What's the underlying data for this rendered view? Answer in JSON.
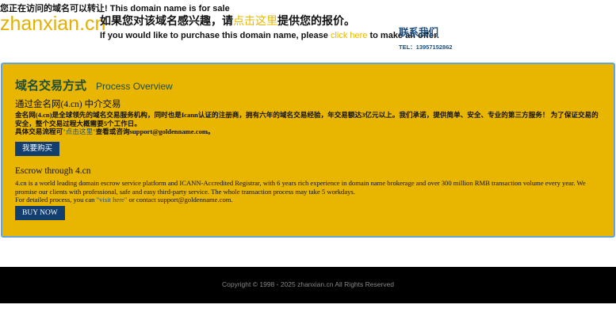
{
  "header": {
    "sale_notice": "您正在访问的域名可以转让! This domain name is for sale",
    "logo_text": "zhanxian.cn",
    "offer_cn_before": "如果您对该域名感兴趣，请",
    "offer_cn_link": "点击这里",
    "offer_cn_after": "提供您的报价。",
    "offer_en_before": "If you would like to purchase this domain name, please ",
    "offer_en_link": "click here",
    "offer_en_after": " to make an offer.",
    "contact_title": "联系我们",
    "contact_tel": "TEL：13957152862"
  },
  "panel": {
    "title": "域名交易方式",
    "subtitle": "Process Overview",
    "cn_section": {
      "heading": "通过金名网(4.cn) 中介交易",
      "text_line1": "金名网(4.cn)是全球领先的域名交易服务机构，同时也是Icann认证的注册商，拥有六年的域名交易经验，年交易额达3亿元以上。我们承诺，提供简单、安全、专业的第三方服务！ 为了保证交易的安全，整个交易过程大概需要5个工作日。",
      "text_line2_before": "具体交易流程可",
      "text_line2_link": "\"点击这里\"",
      "text_line2_after": "查看或咨询support@goldenname.com。",
      "button": "我要购买"
    },
    "en_section": {
      "heading": "Escrow through 4.cn",
      "text_line1": "4.cn is a world leading domain escrow service platform and ICANN-Accredited Registrar, with 6 years rich experience in domain name brokerage and over 300 million RMB transaction volume every year. We promise our clients with professional, safe and easy third-party service. The whole transaction process may take 5 workdays.",
      "text_line2_before": "For detailed process, you can ",
      "text_line2_link": "\"visit here\"",
      "text_line2_after": " or contact support@goldenname.com.",
      "button": "BUY NOW"
    }
  },
  "footer": {
    "copyright": "Copyright © 1998 - 2025 zhanxian.cn All Rights Reserved"
  }
}
